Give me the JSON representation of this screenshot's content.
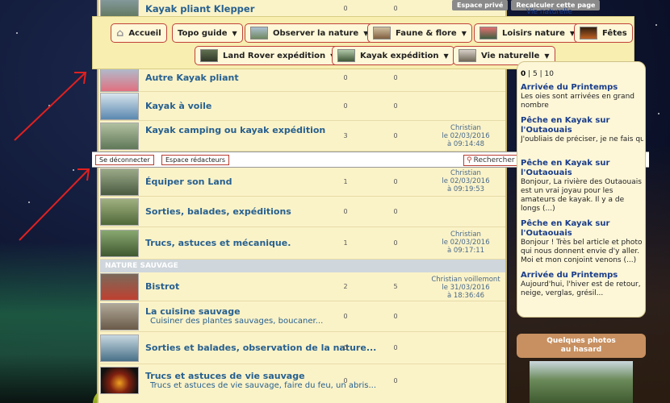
{
  "top_links": {
    "private": "Espace privé",
    "recalc": "Recalculer cette page",
    "side_top": "Vie naturelle"
  },
  "nav": {
    "home": "Accueil",
    "topo": "Topo guide",
    "observe": "Observer la nature",
    "fauna": "Faune & flore",
    "leisure": "Loisirs nature",
    "fetes": "Fêtes",
    "landrover": "Land Rover expédition",
    "kayak": "Kayak expédition",
    "vie": "Vie naturelle"
  },
  "strip": {
    "logout": "Se déconnecter",
    "editors": "Espace rédacteurs",
    "search_placeholder": "Rechercher ...",
    "go": ">>",
    "logo": "forum"
  },
  "rows": [
    {
      "title": "Kayak pliant Klepper",
      "sub": "",
      "c1": "0",
      "c2": "0",
      "last": [
        "",
        "",
        ""
      ]
    },
    {
      "title": "Autre Kayak pliant",
      "sub": "",
      "c1": "0",
      "c2": "0",
      "last": [
        "",
        "",
        ""
      ]
    },
    {
      "title": "Kayak à voile",
      "sub": "",
      "c1": "0",
      "c2": "0",
      "last": [
        "",
        "",
        ""
      ]
    },
    {
      "title": "Kayak camping ou kayak expédition",
      "sub": "",
      "c1": "3",
      "c2": "0",
      "last": [
        "Christian",
        "le 02/03/2016",
        "à 09:14:48"
      ]
    },
    {
      "title": "Équiper son Land",
      "sub": "",
      "c1": "1",
      "c2": "0",
      "last": [
        "Christian",
        "le 02/03/2016",
        "à 09:19:53"
      ]
    },
    {
      "title": "Sorties, balades, expéditions",
      "sub": "",
      "c1": "0",
      "c2": "0",
      "last": [
        "",
        "",
        ""
      ]
    },
    {
      "title": "Trucs, astuces et mécanique.",
      "sub": "",
      "c1": "1",
      "c2": "0",
      "last": [
        "Christian",
        "le 02/03/2016",
        "à 09:17:11"
      ]
    },
    {
      "title": "Bistrot",
      "sub": "",
      "c1": "2",
      "c2": "5",
      "last": [
        "Christian voillemont",
        "le 31/03/2016",
        "à 18:36:46"
      ]
    },
    {
      "title": "La cuisine sauvage",
      "sub": "Cuisiner des plantes sauvages, boucaner...",
      "c1": "0",
      "c2": "0",
      "last": [
        "",
        "",
        ""
      ]
    },
    {
      "title": "Sorties et balades, observation de la nature...",
      "sub": "",
      "c1": "0",
      "c2": "0",
      "last": [
        "",
        "",
        ""
      ]
    },
    {
      "title": "Trucs et astuces de vie sauvage",
      "sub": "Trucs et astuces de vie sauvage, faire du feu, un abris...",
      "c1": "0",
      "c2": "0",
      "last": [
        "",
        "",
        ""
      ]
    }
  ],
  "section": "NATURE SAUVAGE",
  "sidebar": {
    "pager": [
      "0",
      "5",
      "10"
    ],
    "items": [
      {
        "title": "Arrivée du Printemps",
        "body": "Les oies sont arrivées en grand nombre"
      },
      {
        "title": "Pêche en Kayak sur l'Outaouais",
        "body": "J'oubliais de préciser, je ne fais que"
      },
      {
        "title": "Pêche en Kayak sur l'Outaouais",
        "body": "Bonjour, La rivière des Outaouais est un vrai joyau pour les amateurs de kayak. Il y a de longs (...)"
      },
      {
        "title": "Pêche en Kayak sur l'Outaouais",
        "body": "Bonjour ! Très bel article et photo qui nous donnent envie d'y aller. Moi et mon conjoint venons (...)"
      },
      {
        "title": "Arrivée du Printemps",
        "body": "Aujourd'hui, l'hiver est de retour, neige, verglas, grésil..."
      }
    ],
    "photos_title": "Quelques photos au hasard"
  },
  "colors": {
    "accent_border": "#c0403a",
    "link": "#27608f",
    "panel": "#fbf3c8"
  }
}
